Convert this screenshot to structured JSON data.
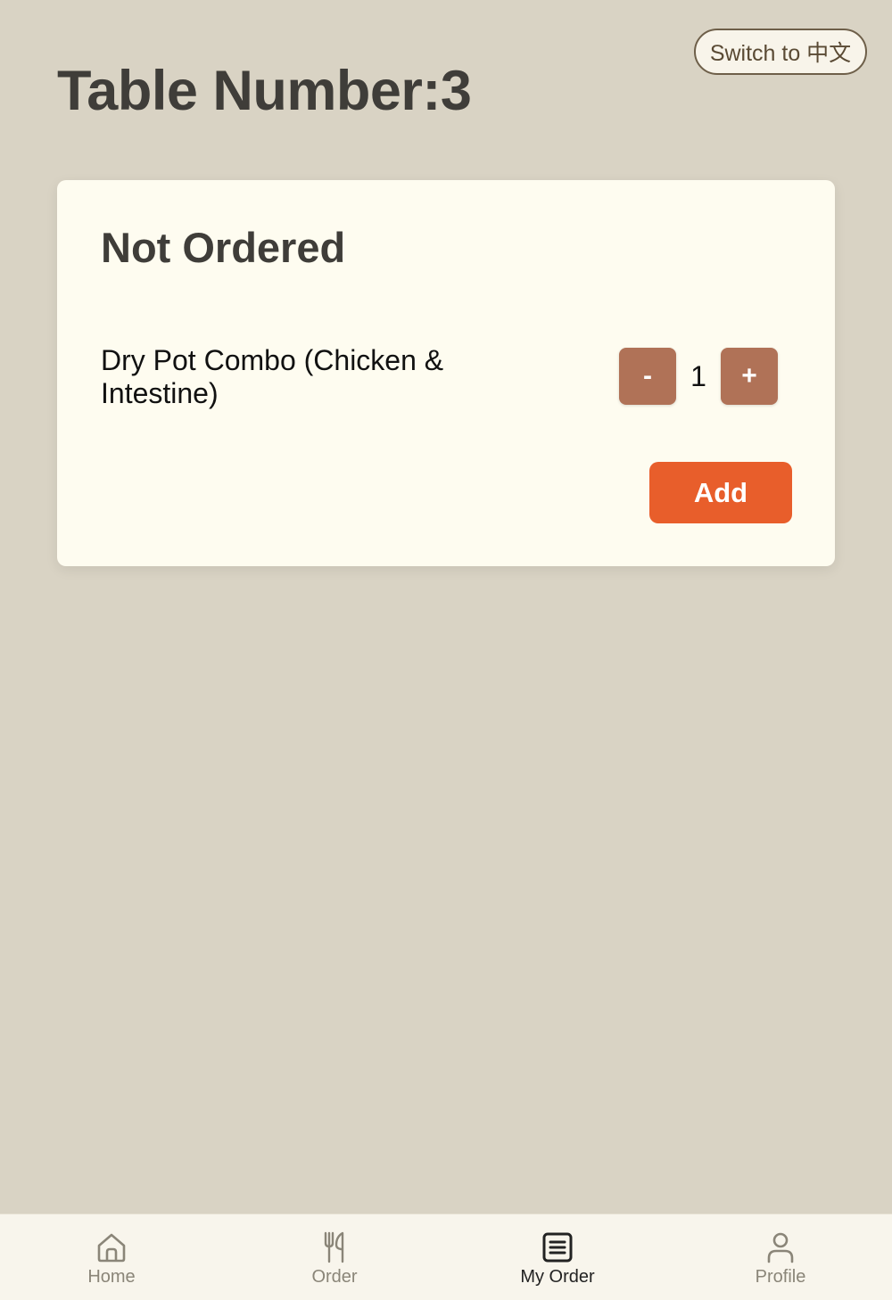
{
  "header": {
    "lang_toggle_label": "Switch to 中文",
    "title": "Table Number:3"
  },
  "order_card": {
    "title": "Not Ordered",
    "items": [
      {
        "name": "Dry Pot Combo (Chicken & Intestine)",
        "decrement_label": "-",
        "quantity": "1",
        "increment_label": "+"
      }
    ],
    "add_label": "Add"
  },
  "bottom_nav": {
    "items": [
      {
        "label": "Home",
        "icon": "home-icon",
        "active": false
      },
      {
        "label": "Order",
        "icon": "fork-knife-icon",
        "active": false
      },
      {
        "label": "My Order",
        "icon": "order-list-icon",
        "active": true
      },
      {
        "label": "Profile",
        "icon": "profile-icon",
        "active": false
      }
    ]
  },
  "colors": {
    "background": "#d9d3c4",
    "card": "#fefcf0",
    "qty_button": "#b07257",
    "add_button": "#e85e2b",
    "nav_active": "#222222",
    "nav_inactive": "#8a8578"
  }
}
